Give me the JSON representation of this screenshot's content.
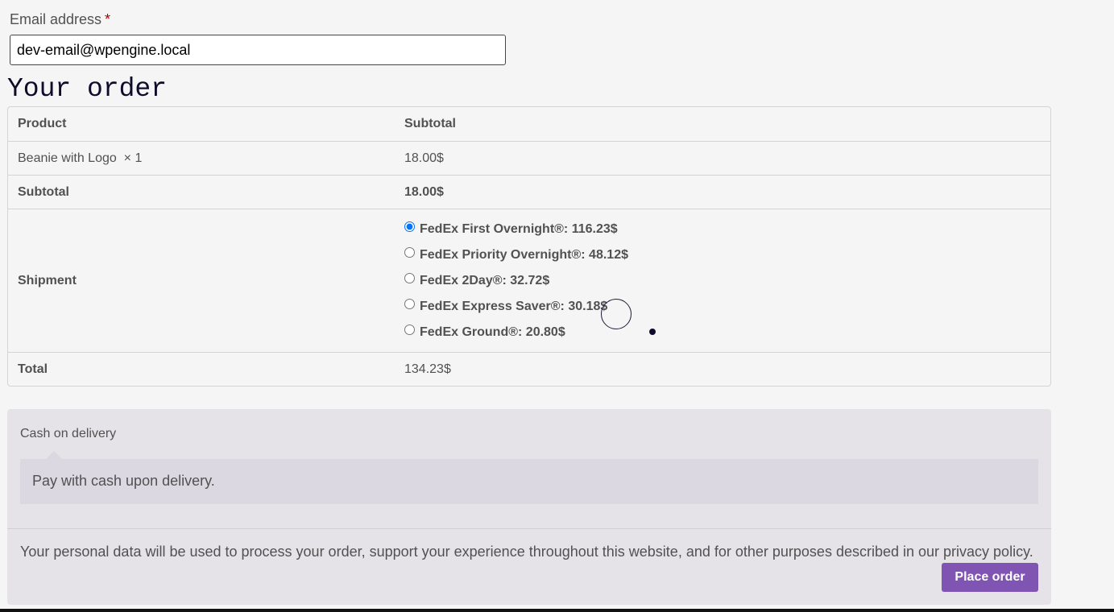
{
  "email": {
    "label": "Email address",
    "required_mark": "*",
    "value": "dev-email@wpengine.local"
  },
  "order": {
    "heading": "Your order",
    "col_product": "Product",
    "col_subtotal": "Subtotal",
    "item_name": "Beanie with Logo",
    "item_qty": "× 1",
    "item_price": "18.00$",
    "subtotal_label": "Subtotal",
    "subtotal_value": "18.00$",
    "shipment_label": "Shipment",
    "shipping_options": [
      {
        "label": "FedEx First Overnight®: 116.23$",
        "selected": true
      },
      {
        "label": "FedEx Priority Overnight®: 48.12$",
        "selected": false
      },
      {
        "label": "FedEx 2Day®: 32.72$",
        "selected": false
      },
      {
        "label": "FedEx Express Saver®: 30.18$",
        "selected": false
      },
      {
        "label": "FedEx Ground®: 20.80$",
        "selected": false
      }
    ],
    "total_label": "Total",
    "total_value": "134.23$"
  },
  "payment": {
    "method": "Cash on delivery",
    "description": "Pay with cash upon delivery.",
    "privacy_text": "Your personal data will be used to process your order, support your experience throughout this website, and for other purposes described in our",
    "privacy_link": "privacy policy",
    "privacy_end": ".",
    "place_order": "Place order"
  },
  "colors": {
    "button": "#7f54b3",
    "background": "#f5f5f5",
    "payment_bg": "#e5e3e8"
  }
}
